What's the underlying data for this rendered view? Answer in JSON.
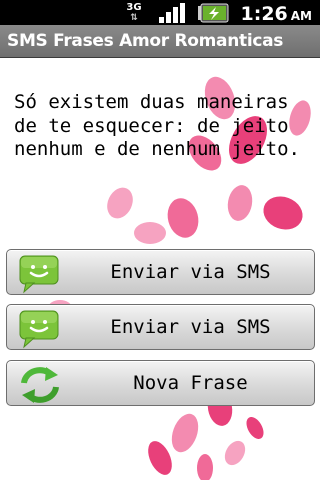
{
  "status_bar": {
    "network": "3G",
    "network_icon": "3g-data-icon",
    "signal_icon": "signal-strength-icon",
    "battery_icon": "battery-charging-icon",
    "time": "1:26",
    "ampm": "AM"
  },
  "app": {
    "title": "SMS Frases Amor Romanticas"
  },
  "message": "Só existem duas maneiras de te esquecer: de jeito nenhum e de nenhum jeito.",
  "buttons": {
    "send_sms_1": {
      "label": "Enviar via SMS",
      "icon": "sms-chat-bubble-icon"
    },
    "send_sms_2": {
      "label": "Enviar via SMS",
      "icon": "sms-chat-bubble-icon"
    },
    "new_phrase": {
      "label": "Nova Frase",
      "icon": "refresh-arrows-icon"
    }
  },
  "colors": {
    "petal": "#e8407a",
    "petal_light": "#f38bb0",
    "sms_icon_green": "#7cc43a",
    "refresh_green": "#4fb83a"
  }
}
